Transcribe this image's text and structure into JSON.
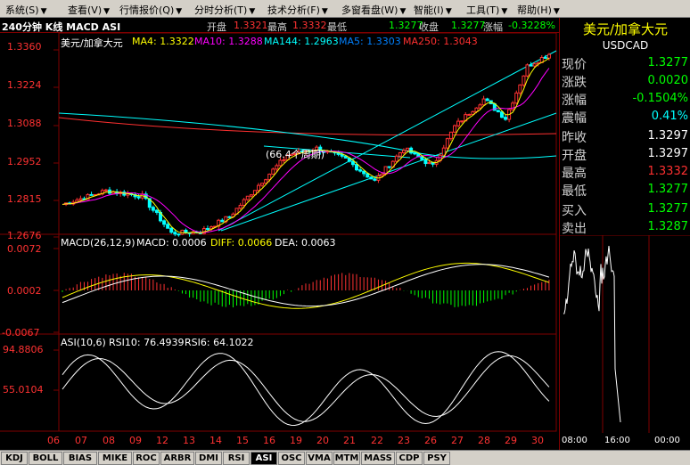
{
  "menu": [
    {
      "label": "系统(S)"
    },
    {
      "label": "查看(V)"
    },
    {
      "label": "行情报价(Q)"
    },
    {
      "label": "分时分析(T)"
    },
    {
      "label": "技术分析(F)"
    },
    {
      "label": "多窗看盘(W)"
    },
    {
      "label": "智能(I)"
    },
    {
      "label": "工具(T)"
    },
    {
      "label": "帮助(H)"
    }
  ],
  "header": {
    "period": "240分钟 K线 MACD ASI",
    "open_label": "开盘",
    "open_value": "1.3321",
    "high_label": "最高",
    "high_value": "1.3332",
    "low_label": "最低",
    "low_value": "1.3277",
    "close_label": "收盘",
    "close_value": "1.3277",
    "change_label": "涨幅",
    "change_value": "-0.3228%"
  },
  "main_panel": {
    "legend": {
      "name": "美元/加拿大元",
      "ma4": "MA4: 1.3322",
      "ma10": "MA10: 1.3288",
      "ma144": "MA144: 1.2963",
      "ma5": "MA5: 1.3303",
      "ma250": "MA250: 1.3043"
    },
    "y_ticks": [
      "1.3360",
      "1.3224",
      "1.3088",
      "1.2952",
      "1.2815",
      "1.2676"
    ],
    "annotation": "(66.4个周期)"
  },
  "macd_panel": {
    "legend_name": "MACD(26,12,9)",
    "macd": "MACD: 0.0006",
    "diff": "DIFF: 0.0066",
    "dea": "DEA: 0.0063",
    "y_ticks": [
      "0.0072",
      "0.0002",
      "-0.0067"
    ]
  },
  "asi_panel": {
    "legend_name": "ASI(10,6)",
    "rsi10": "RSI10: 76.4939",
    "rsi6": "RSI6: 64.1022",
    "y_ticks": [
      "94.8806",
      "55.0104"
    ]
  },
  "x_axis": [
    "06",
    "07",
    "08",
    "09",
    "12",
    "13",
    "14",
    "15",
    "16",
    "19",
    "20",
    "21",
    "22",
    "23",
    "26",
    "27",
    "28",
    "29",
    "30"
  ],
  "right_panel": {
    "title": "美元/加拿大元",
    "code": "USDCAD",
    "rows": [
      {
        "label": "现价",
        "value": "1.3277",
        "color": "#00ff00"
      },
      {
        "label": "涨跌",
        "value": "0.0020",
        "color": "#00ff00"
      },
      {
        "label": "涨幅",
        "value": "-0.1504%",
        "color": "#00ff00"
      },
      {
        "label": "震幅",
        "value": "0.41%",
        "color": "#00ffff"
      },
      {
        "label": "昨收",
        "value": "1.3297",
        "color": "#ffffff"
      },
      {
        "label": "开盘",
        "value": "1.3297",
        "color": "#ffffff"
      },
      {
        "label": "最高",
        "value": "1.3332",
        "color": "#ff3030"
      },
      {
        "label": "最低",
        "value": "1.3277",
        "color": "#00ff00"
      },
      {
        "label": "买入",
        "value": "1.3277",
        "color": "#00ff00"
      },
      {
        "label": "卖出",
        "value": "1.3287",
        "color": "#00ff00"
      }
    ],
    "mini_times": [
      "08:00",
      "16:00",
      "00:00"
    ]
  },
  "tabs": [
    "KDJ",
    "BOLL",
    "BIAS",
    "MIKE",
    "ROC",
    "ARBR",
    "DMI",
    "RSI",
    "ASI",
    "OSC",
    "VMA",
    "MTM",
    "MASS",
    "CDP",
    "PSY"
  ],
  "active_tab": "ASI",
  "colors": {
    "up": "#ff3232",
    "down": "#00ffff",
    "ma4": "#ffff00",
    "ma10": "#ff00ff",
    "ma144": "#00ffff",
    "ma5": "#0080ff",
    "ma250": "#ff3030",
    "axis": "#800000"
  }
}
